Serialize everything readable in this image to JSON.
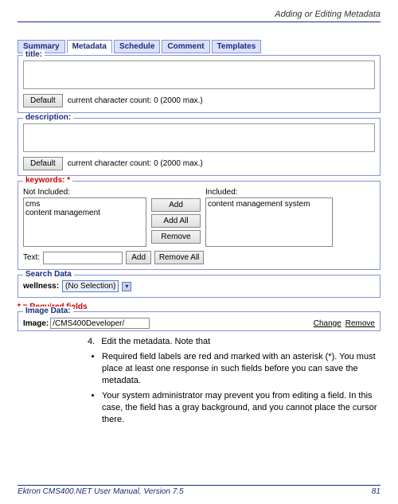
{
  "page": {
    "header_title": "Adding or Editing Metadata",
    "page_number": "81",
    "footer_text": "Ektron CMS400.NET User Manual, Version 7.5"
  },
  "tabs": {
    "items": [
      "Summary",
      "Metadata",
      "Schedule",
      "Comment",
      "Templates"
    ],
    "active": "Metadata"
  },
  "title_section": {
    "legend": "title:",
    "default_btn": "Default",
    "charcount": "current character count: 0  (2000 max.)"
  },
  "desc_section": {
    "legend": "description:",
    "default_btn": "Default",
    "charcount": "current character count: 0  (2000 max.)"
  },
  "keywords_section": {
    "legend": "keywords: *",
    "not_included_label": "Not Included:",
    "included_label": "Included:",
    "not_included_items": "cms\ncontent management",
    "included_items": "content management system",
    "add_btn": "Add",
    "addall_btn": "Add All",
    "remove_btn": "Remove",
    "removeall_btn": "Remove All",
    "text_label": "Text:",
    "text_add_btn": "Add"
  },
  "search_section": {
    "legend": "Search Data",
    "wellness_label": "wellness:",
    "wellness_value": "(No Selection)"
  },
  "required_note": "* = Required fields",
  "image_section": {
    "legend": "Image Data:",
    "image_label": "Image:",
    "image_value": "/CMS400Developer/",
    "change": "Change",
    "remove": "Remove"
  },
  "instructions": {
    "step4": "Edit the metadata. Note that",
    "bullet1": "Required field labels are red and marked with an asterisk (*). You must place at least one response in such fields before you can save the metadata.",
    "bullet2": "Your system administrator may prevent you from editing a field. In this case, the field has a gray background, and you cannot place the cursor there."
  }
}
